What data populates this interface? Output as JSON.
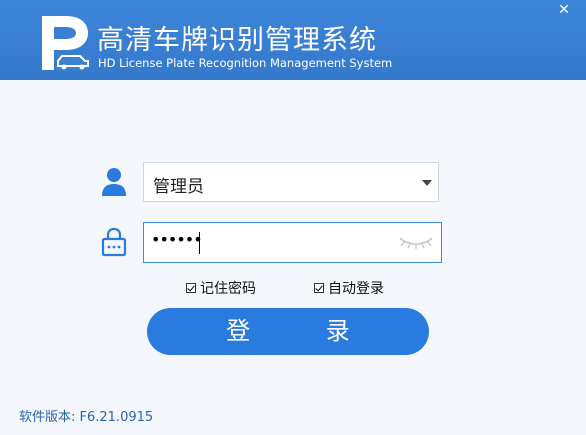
{
  "header": {
    "title_cn": "高清车牌识别管理系统",
    "title_en": "HD License Plate Recognition Management System",
    "close_glyph": "✕"
  },
  "login": {
    "username_value": "管理员",
    "password_mask": "••••••",
    "remember_label": "记住密码",
    "remember_checked": true,
    "autologin_label": "自动登录",
    "autologin_checked": true,
    "login_button": "登 录"
  },
  "footer": {
    "version": "软件版本: F6.21.0915"
  },
  "colors": {
    "header": "#3d86d9",
    "accent": "#2a7be0",
    "background": "#f4f7fc",
    "version_text": "#2b62b5"
  },
  "icons": [
    "parking-car-logo",
    "user-icon",
    "lock-icon",
    "eye-closed-icon",
    "dropdown-arrow-icon",
    "close-icon"
  ]
}
